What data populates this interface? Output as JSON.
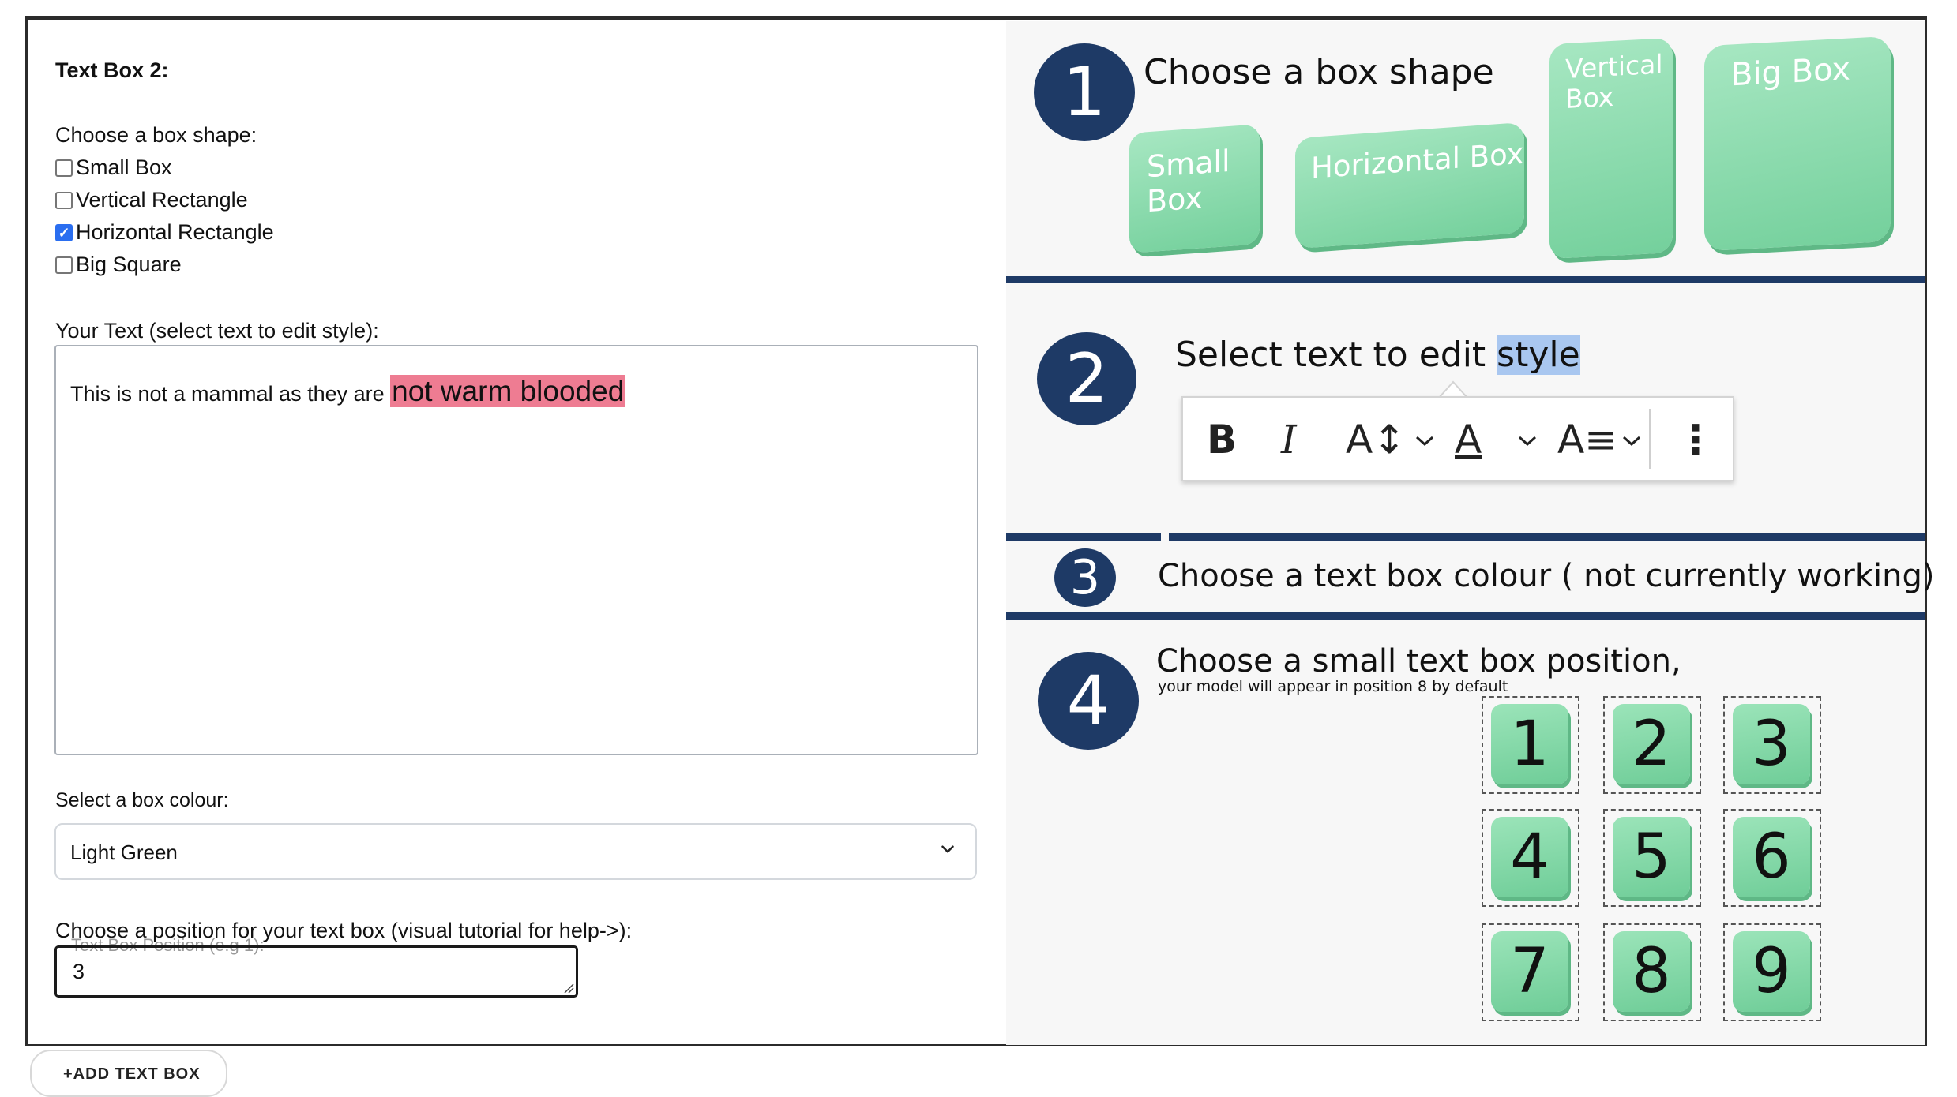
{
  "form": {
    "section_title": "Text Box 2:",
    "shape_label": "Choose a box shape:",
    "shape_options": [
      {
        "label": "Small Box",
        "checked": false
      },
      {
        "label": "Vertical Rectangle",
        "checked": false
      },
      {
        "label": "Horizontal Rectangle",
        "checked": true
      },
      {
        "label": "Big Square",
        "checked": false
      }
    ],
    "text_label": "Your Text (select text to edit style):",
    "text_plain": "This is not a mammal as they are ",
    "text_highlight": "not warm blooded",
    "highlight_color": "#ee7c92",
    "colour_label": "Select a box colour:",
    "colour_value": "Light Green",
    "position_label": "Choose a position for your text box (visual tutorial for help->):",
    "position_placeholder": "Text Box Position (e.g 1):",
    "position_value": "3",
    "add_button": "+ADD TEXT BOX"
  },
  "tutorial": {
    "accent": "#1e3a66",
    "shape_color": "#74d09c",
    "step1": {
      "number": "1",
      "title": "Choose a box shape",
      "shapes": [
        "Small Box",
        "Horizontal Box",
        "Vertical Box",
        "Big Box"
      ]
    },
    "step2": {
      "number": "2",
      "title_plain": "Select text to edit ",
      "title_selected": "style",
      "toolbar": {
        "bold": "B",
        "italic": "I",
        "size": "A↕",
        "color": "A",
        "format": "A≡",
        "more": "⋮"
      }
    },
    "step3": {
      "number": "3",
      "title": "Choose a text box colour ( not currently working)"
    },
    "step4": {
      "number": "4",
      "title": "Choose a small text box position,",
      "note": "your model will appear in position 8 by default",
      "positions": [
        "1",
        "2",
        "3",
        "4",
        "5",
        "6",
        "7",
        "8",
        "9"
      ]
    }
  }
}
